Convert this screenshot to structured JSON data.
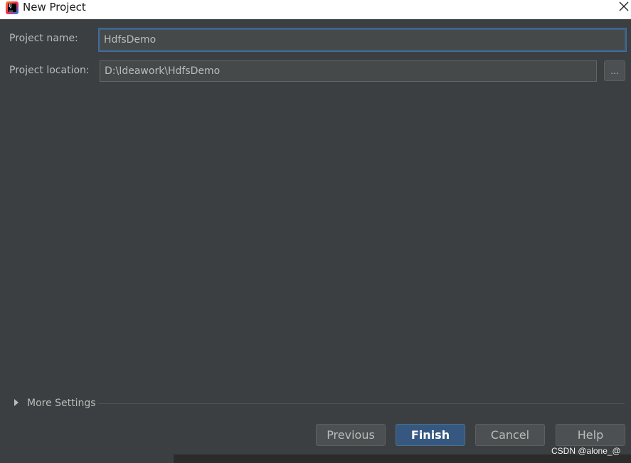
{
  "window": {
    "title": "New Project"
  },
  "form": {
    "project_name_label": "Project name:",
    "project_name_value": "HdfsDemo",
    "project_location_label": "Project location:",
    "project_location_value": "D:\\Ideawork\\HdfsDemo",
    "browse_label": "..."
  },
  "more_settings": {
    "label": "More Settings"
  },
  "buttons": {
    "previous": "Previous",
    "finish": "Finish",
    "cancel": "Cancel",
    "help": "Help"
  },
  "watermark": "CSDN @alone_@",
  "icons": {
    "app": "intellij-idea-icon",
    "close": "close-icon",
    "expand": "triangle-right-icon"
  },
  "colors": {
    "background": "#3c3f41",
    "field_background": "#45494a",
    "primary_button": "#365880",
    "focus_border": "#3d6185",
    "text": "#bbbbbb"
  }
}
